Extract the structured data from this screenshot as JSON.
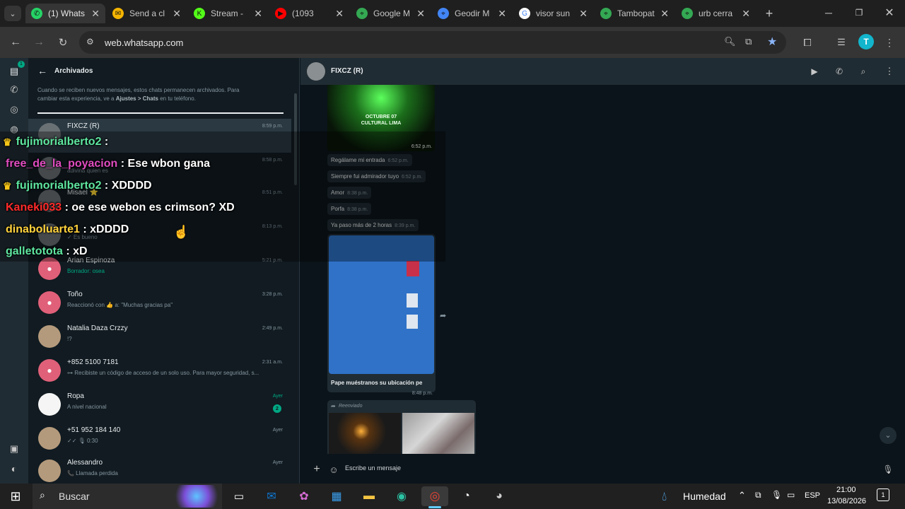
{
  "browser": {
    "tabs": [
      {
        "title": "(1) Whats",
        "color": "#25d366",
        "glyph": "✆"
      },
      {
        "title": "Send a cl",
        "color": "#f4b400",
        "glyph": "✉"
      },
      {
        "title": "Stream - ",
        "color": "#53fc18",
        "glyph": "K"
      },
      {
        "title": "(1093",
        "color": "#ff0000",
        "glyph": "▶"
      },
      {
        "title": "Google M",
        "color": "#34a853",
        "glyph": "⌖"
      },
      {
        "title": "Geodir M",
        "color": "#4285f4",
        "glyph": "⌖"
      },
      {
        "title": "visor sun",
        "color": "#ffffff",
        "glyph": "G"
      },
      {
        "title": "Tambopat",
        "color": "#34a853",
        "glyph": "⌖"
      },
      {
        "title": "urb cerra",
        "color": "#34a853",
        "glyph": "⌖"
      }
    ],
    "url": "web.whatsapp.com",
    "profile_initial": "T"
  },
  "sidebar": {
    "header_title": "Archivados",
    "archive_info_1": "Cuando se reciben nuevos mensajes, estos chats permanecen archivados. Para",
    "archive_info_2_a": "cambiar esta experiencia, ve a ",
    "archive_info_2_b": "Ajustes > Chats",
    "archive_info_2_c": " en tu teléfono.",
    "chats": [
      {
        "name": "FIXCZ (R)",
        "sub": "",
        "time": "8:59 p.m."
      },
      {
        "name": "",
        "sub": "adivina quien es",
        "time": "8:58 p.m."
      },
      {
        "name": "Misael ⭐",
        "sub": "",
        "time": "8:51 p.m."
      },
      {
        "name": "",
        "sub": "✓ Es bueno",
        "time": "8:13 p.m."
      },
      {
        "name": "Arian Espinoza",
        "sub": "Borrador: osea",
        "time": "5:21 p.m."
      },
      {
        "name": "Toño",
        "sub": "Reaccionó con 👍 a: \"Muchas gracias pa\"",
        "time": "3:28 p.m."
      },
      {
        "name": "Natalia Daza Crzzy",
        "sub": "!?",
        "time": "2:49 p.m."
      },
      {
        "name": "+852 5100 7181",
        "sub": "⊶ Recibiste un código de acceso de un solo uso. Para mayor seguridad, s...",
        "time": "2:31 a.m."
      },
      {
        "name": "Ropa",
        "sub": "A nivel nacional",
        "time": "Ayer",
        "badge": "2"
      },
      {
        "name": "+51 952 184 140",
        "sub": "✓✓ 🎙 0:30",
        "time": "Ayer"
      },
      {
        "name": "Alessandro",
        "sub": "📞 Llamada perdida",
        "time": "Ayer"
      }
    ]
  },
  "chat": {
    "contact_name": "FIXCZ (R)",
    "poster_line1": "OCTUBRE 07",
    "poster_line2": "CULTURAL LIMA",
    "poster_time": "6:52 p.m.",
    "messages": [
      {
        "text": "Regálame mi entrada",
        "time": "6:52 p.m."
      },
      {
        "text": "Siempre fui admirador tuyo",
        "time": "6:52 p.m."
      },
      {
        "text": "Amor",
        "time": "8:38 p.m."
      },
      {
        "text": "Porfa",
        "time": "8:38 p.m."
      },
      {
        "text": "Ya paso más de 2 horas",
        "time": "8:39 p.m."
      }
    ],
    "doc_caption": "Pape muéstranos su ubicación pe",
    "doc_time": "8:48 p.m.",
    "forwarded_label": "Reenviado",
    "composer_placeholder": "Escribe un mensaje"
  },
  "stream_overlay": [
    {
      "user": "fujimorialberto2",
      "msg": " : ",
      "color": "#5ee6a0",
      "crown": true
    },
    {
      "user": "free_de_la_poyacion",
      "msg": " : Ese wbon gana",
      "color": "#e04cc0",
      "crown": false
    },
    {
      "user": "fujimorialberto2",
      "msg": " : XDDDD",
      "color": "#5ee6a0",
      "crown": true
    },
    {
      "user": "Kaneki033",
      "msg": " : oe ese webon es crimson? XD",
      "color": "#ff2a2a",
      "crown": false
    },
    {
      "user": "dinaboluarte1",
      "msg": " : xDDDD",
      "color": "#ffd23c",
      "crown": false
    },
    {
      "user": "galletotota",
      "msg": " : xD",
      "color": "#5ee6a0",
      "crown": false
    }
  ],
  "taskbar": {
    "search_label": "Buscar",
    "weather_label": "Humedad",
    "lang": "ESP",
    "time": "21:00",
    "date": "13/08/2026",
    "notif_count": "1"
  },
  "colors": {
    "wa_green": "#00a884",
    "wa_bg": "#0b141a",
    "panel": "#111b21"
  }
}
